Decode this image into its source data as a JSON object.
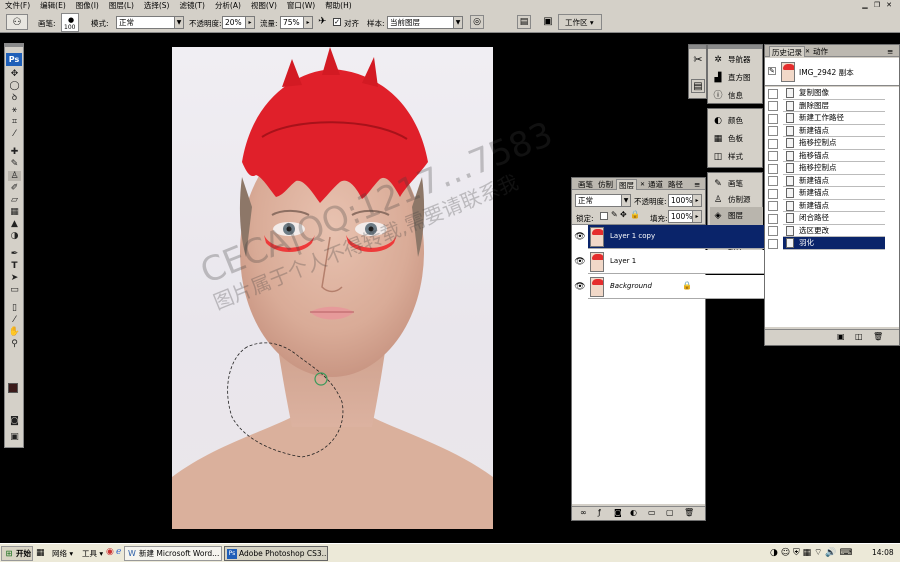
{
  "menu": [
    "文件(F)",
    "编辑(E)",
    "图像(I)",
    "图层(L)",
    "选择(S)",
    "滤镜(T)",
    "分析(A)",
    "视图(V)",
    "窗口(W)",
    "帮助(H)"
  ],
  "options_bar": {
    "brush_label": "画笔:",
    "brush_size": "100",
    "mode_label": "模式:",
    "mode_value": "正常",
    "opacity_label": "不透明度:",
    "opacity_value": "20%",
    "flow_label": "流量:",
    "flow_value": "75%",
    "aligned_label": "对齐",
    "sample_label": "样本:",
    "sample_value": "当前图层",
    "workspace_label": "工作区"
  },
  "toolbox": {
    "logo": "Ps",
    "icons": [
      "move-tool-icon",
      "marquee-tool-icon",
      "lasso-tool-icon",
      "magic-wand-tool-icon",
      "crop-tool-icon",
      "eyedropper-tool-icon",
      "healing-brush-tool-icon",
      "brush-tool-icon",
      "clone-stamp-tool-icon",
      "history-brush-tool-icon",
      "eraser-tool-icon",
      "gradient-tool-icon",
      "blur-tool-icon",
      "dodge-tool-icon",
      "pen-tool-icon",
      "type-tool-icon",
      "path-selection-tool-icon",
      "shape-tool-icon",
      "notes-tool-icon",
      "eyedropper-2-tool-icon",
      "hand-tool-icon",
      "zoom-tool-icon"
    ],
    "foreground_color": "#3a1a1a",
    "background_color": "#ffffff"
  },
  "dock": {
    "group1": [
      "导航器",
      "直方图",
      "信息"
    ],
    "group2": [
      "颜色",
      "色板",
      "样式"
    ],
    "group3": [
      "画笔",
      "仿制源",
      "图层",
      "通道",
      "路径"
    ]
  },
  "layers_panel": {
    "tabs": [
      "画笔",
      "仿制",
      "图层",
      "通道",
      "路径"
    ],
    "blend_mode": "正常",
    "opacity_label": "不透明度:",
    "opacity_value": "100%",
    "lock_label": "锁定:",
    "fill_label": "填充:",
    "fill_value": "100%",
    "layers": [
      {
        "name": "Layer 1 copy"
      },
      {
        "name": "Layer 1"
      },
      {
        "name": "Background"
      }
    ]
  },
  "history_panel": {
    "tabs": [
      "历史记录",
      "动作"
    ],
    "snapshot": "IMG_2942 副本",
    "items": [
      "复制图像",
      "删除图层",
      "新建工作路径",
      "新建锚点",
      "拖移控制点",
      "拖移锚点",
      "拖移控制点",
      "新建锚点",
      "新建锚点",
      "新建锚点",
      "闭合路径",
      "选区更改",
      "羽化"
    ]
  },
  "watermark": {
    "line1": "CECA|QQ:1217…7583",
    "line2": "图片属于个人不得转载,需要请联系我"
  },
  "taskbar": {
    "start": "开始",
    "net_label": "网络",
    "tools_label": "工具",
    "tasks": [
      "新建 Microsoft Word...",
      "Adobe Photoshop CS3..."
    ],
    "clock": "14:08"
  }
}
